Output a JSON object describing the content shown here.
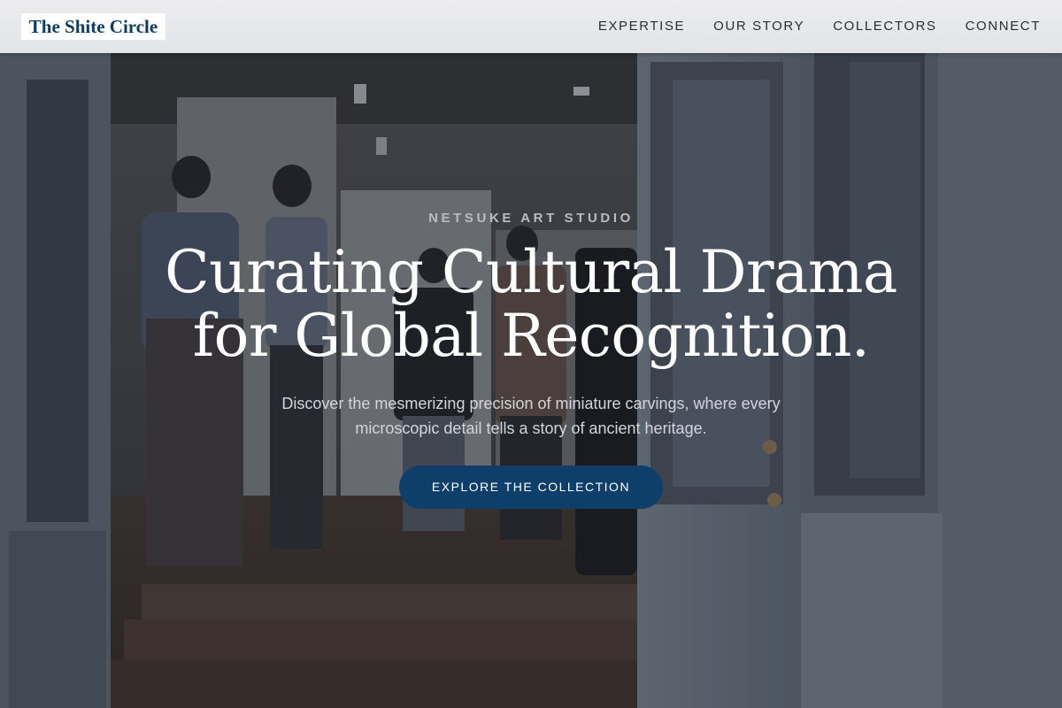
{
  "header": {
    "logo_text": "The Shite Circle",
    "nav": [
      {
        "label": "EXPERTISE"
      },
      {
        "label": "OUR STORY"
      },
      {
        "label": "COLLECTORS"
      },
      {
        "label": "CONNECT"
      }
    ]
  },
  "hero": {
    "background_image": "gallery-entrance-photo",
    "eyebrow": "NETSUKE ART STUDIO",
    "headline_line1": "Curating Cultural Drama",
    "headline_line2": "for Global Recognition.",
    "subtext": "Discover the mesmerizing precision of miniature carvings, where every microscopic detail tells a story of ancient heritage.",
    "cta_label": "EXPLORE THE COLLECTION"
  },
  "colors": {
    "brand": "#0e3c5e",
    "cta_background": "#0e3f6b",
    "header_background": "#e6e7e9",
    "nav_text": "#2a2d33",
    "headline_text": "#ffffff"
  }
}
